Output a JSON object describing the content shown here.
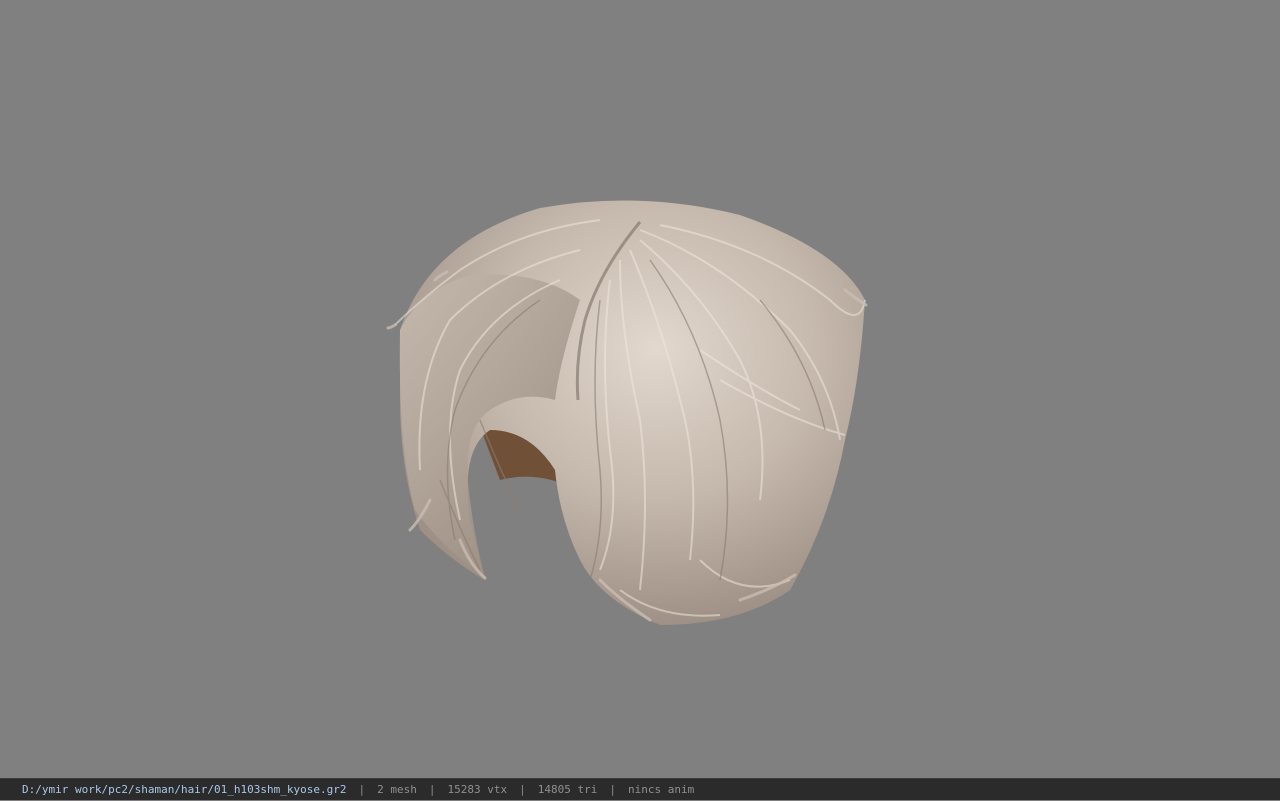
{
  "viewport": {
    "background_color": "#808080",
    "model_icon": "hair-mesh-model",
    "hair_colors": {
      "light": "#d8cdc3",
      "mid": "#b8aba0",
      "dark": "#8a7c70",
      "scalp": "#8a5a36"
    }
  },
  "statusbar": {
    "file_path": "D:/ymir work/pc2/shaman/hair/01_h103shm_kyose.gr2",
    "separator": "|",
    "mesh_count": "2 mesh",
    "vertex_count": "15283 vtx",
    "triangle_count": "14805 tri",
    "anim_status": "nincs anim",
    "path_color": "#a9c6e8",
    "text_color": "#8f8f8f"
  }
}
